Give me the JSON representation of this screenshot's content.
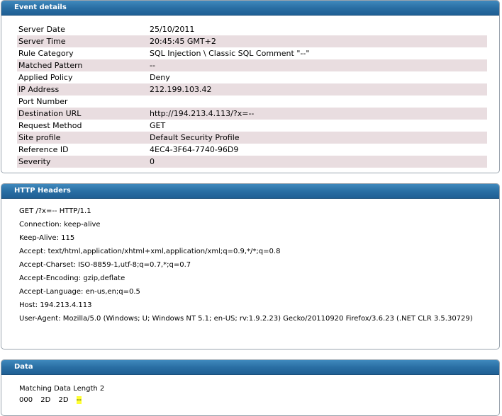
{
  "event_details": {
    "title": "Event details",
    "rows": [
      {
        "key": "Server Date",
        "value": "25/10/2011"
      },
      {
        "key": "Server Time",
        "value": "20:45:45 GMT+2"
      },
      {
        "key": "Rule Category",
        "value": "SQL Injection \\ Classic SQL Comment \"--\""
      },
      {
        "key": "Matched Pattern",
        "value": "--"
      },
      {
        "key": "Applied Policy",
        "value": "Deny"
      },
      {
        "key": "IP Address",
        "value": "212.199.103.42"
      },
      {
        "key": "Port Number",
        "value": ""
      },
      {
        "key": "Destination URL",
        "value": "http://194.213.4.113/?x=--"
      },
      {
        "key": "Request Method",
        "value": "GET"
      },
      {
        "key": "Site profile",
        "value": "Default Security Profile"
      },
      {
        "key": "Reference ID",
        "value": "4EC4-3F64-7740-96D9"
      },
      {
        "key": "Severity",
        "value": "0"
      }
    ]
  },
  "http_headers": {
    "title": "HTTP Headers",
    "lines": [
      "GET /?x=-- HTTP/1.1",
      "Connection: keep-alive",
      "Keep-Alive: 115",
      "Accept: text/html,application/xhtml+xml,application/xml;q=0.9,*/*;q=0.8",
      "Accept-Charset: ISO-8859-1,utf-8;q=0.7,*;q=0.7",
      "Accept-Encoding: gzip,deflate",
      "Accept-Language: en-us,en;q=0.5",
      "Host: 194.213.4.113",
      "User-Agent: Mozilla/5.0 (Windows; U; Windows NT 5.1; en-US; rv:1.9.2.23) Gecko/20110920 Firefox/3.6.23 (.NET CLR 3.5.30729)"
    ]
  },
  "data": {
    "title": "Data",
    "matching_length": "Matching Data Length 2",
    "offset": "000",
    "hex1": "2D",
    "hex2": "2D",
    "ascii": "--",
    "highlight_color": "#ffff33"
  },
  "colors": {
    "header_bar": "#2a6fa4",
    "alt_row": "#e9dde0"
  }
}
